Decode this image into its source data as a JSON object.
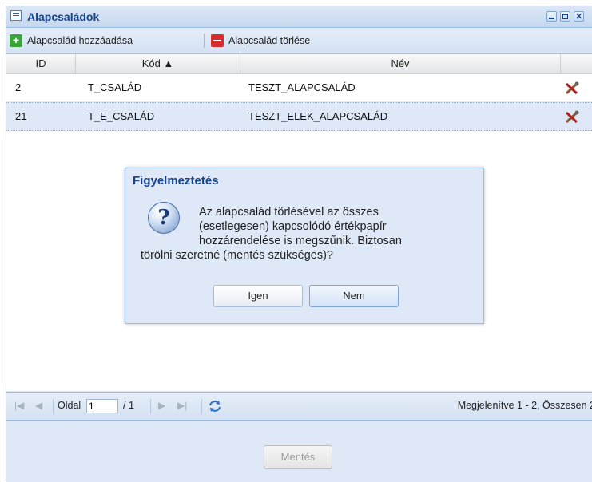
{
  "window": {
    "title": "Alapcsaládok"
  },
  "toolbar": {
    "add_label": "Alapcsalád hozzáadása",
    "delete_label": "Alapcsalád törlése"
  },
  "grid": {
    "columns": [
      "ID",
      "Kód ▲",
      "Név"
    ],
    "rows": [
      {
        "id": "2",
        "code": "T_CSALÁD",
        "name": "TESZT_ALAPCSALÁD"
      },
      {
        "id": "21",
        "code": "T_E_CSALÁD",
        "name": "TESZT_ELEK_ALAPCSALÁD"
      }
    ]
  },
  "pager": {
    "page_label": "Oldal",
    "page_value": "1",
    "page_total": "/ 1",
    "summary": "Megjelenítve 1 - 2, Összesen 2"
  },
  "footer": {
    "save_label": "Mentés"
  },
  "dialog": {
    "title": "Figyelmeztetés",
    "lines": [
      "Az alapcsalád törlésével az összes",
      "(esetlegesen) kapcsolódó értékpapír",
      "hozzárendelése is megszűnik. Biztosan",
      "törölni szeretné (mentés szükséges)?"
    ],
    "yes_label": "Igen",
    "no_label": "Nem"
  }
}
